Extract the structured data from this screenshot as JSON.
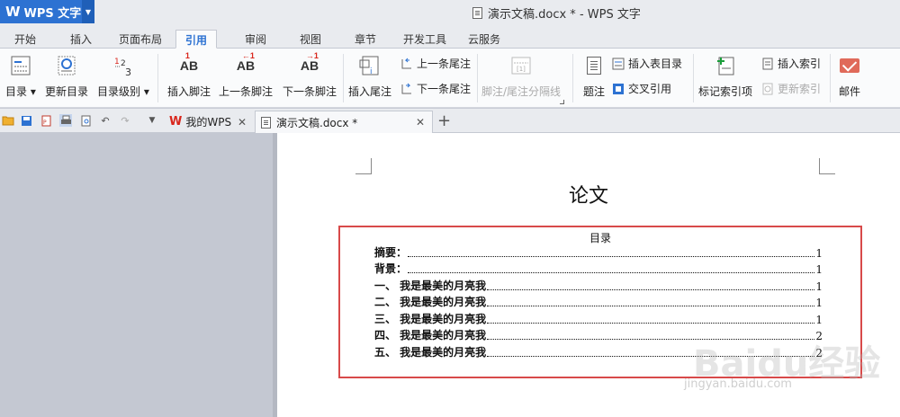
{
  "app": {
    "name": "WPS 文字",
    "logo": "W"
  },
  "window": {
    "title": "演示文稿.docx * - WPS 文字"
  },
  "ribbon_tabs": [
    "开始",
    "插入",
    "页面布局",
    "引用",
    "审阅",
    "视图",
    "章节",
    "开发工具",
    "云服务"
  ],
  "active_tab": "引用",
  "ribbon": {
    "toc": "目录",
    "update_toc": "更新目录",
    "toc_level": "目录级别",
    "insert_footnote": "插入脚注",
    "prev_footnote": "上一条脚注",
    "next_footnote": "下一条脚注",
    "insert_endnote": "插入尾注",
    "prev_endnote": "上一条尾注",
    "next_endnote": "下一条尾注",
    "separator": "脚注/尾注分隔线",
    "caption": "题注",
    "insert_table_of_figures": "插入表目录",
    "cross_reference": "交叉引用",
    "mark_entry": "标记索引项",
    "insert_index": "插入索引",
    "update_index": "更新索引",
    "mail": "邮件"
  },
  "doc_tabs": [
    {
      "label": "我的WPS"
    },
    {
      "label": "演示文稿.docx *"
    }
  ],
  "document": {
    "title": "论文",
    "toc_heading": "目录",
    "toc_entries": [
      {
        "title": "摘要：",
        "page": "1"
      },
      {
        "title": "背景：",
        "page": "1"
      },
      {
        "title": "一、 我是最美的月亮我",
        "page": "1"
      },
      {
        "title": "二、 我是最美的月亮我",
        "page": "1"
      },
      {
        "title": "三、 我是最美的月亮我",
        "page": "1"
      },
      {
        "title": "四、 我是最美的月亮我",
        "page": "2"
      },
      {
        "title": "五、 我是最美的月亮我",
        "page": "2"
      }
    ]
  },
  "watermark": {
    "brand": "Baidu经验",
    "url": "jingyan.baidu.com"
  },
  "colors": {
    "accent": "#2d72d2",
    "highlight_box": "#d84a4a",
    "wps_red": "#d9261c"
  }
}
